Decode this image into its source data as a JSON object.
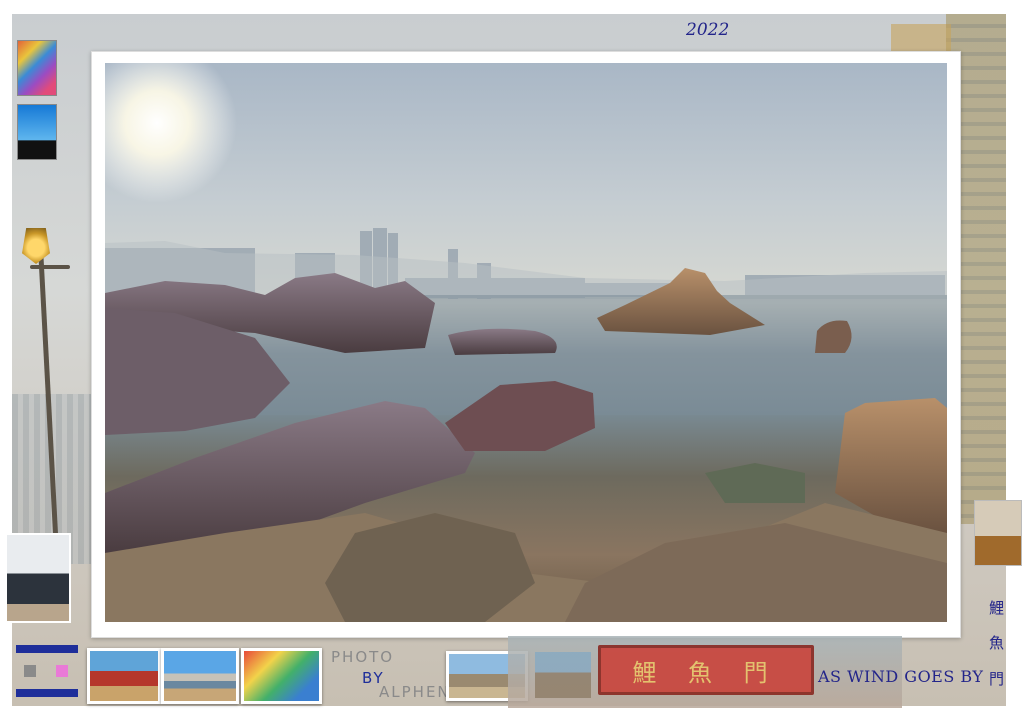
{
  "header": {
    "year": "2022"
  },
  "credits": {
    "photo": "PHOTO",
    "by": "BY",
    "author": "ALPHEN"
  },
  "tagline": "AS WIND GOES BY",
  "vertical_title": [
    "鯉",
    "魚",
    "門"
  ],
  "sign_text": "鯉 魚 門",
  "colors": {
    "accent_blue": "#23258a",
    "flag_blue": "#1e2e9a",
    "flag_pink": "#e97ad7",
    "flag_grey": "#8a8a8a"
  },
  "thumbnails": [
    "stained-glass",
    "silhouette-dancer",
    "person-portrait",
    "hiker",
    "chinese-gate",
    "harbour-bay",
    "colorful-mural",
    "rock-formation"
  ]
}
